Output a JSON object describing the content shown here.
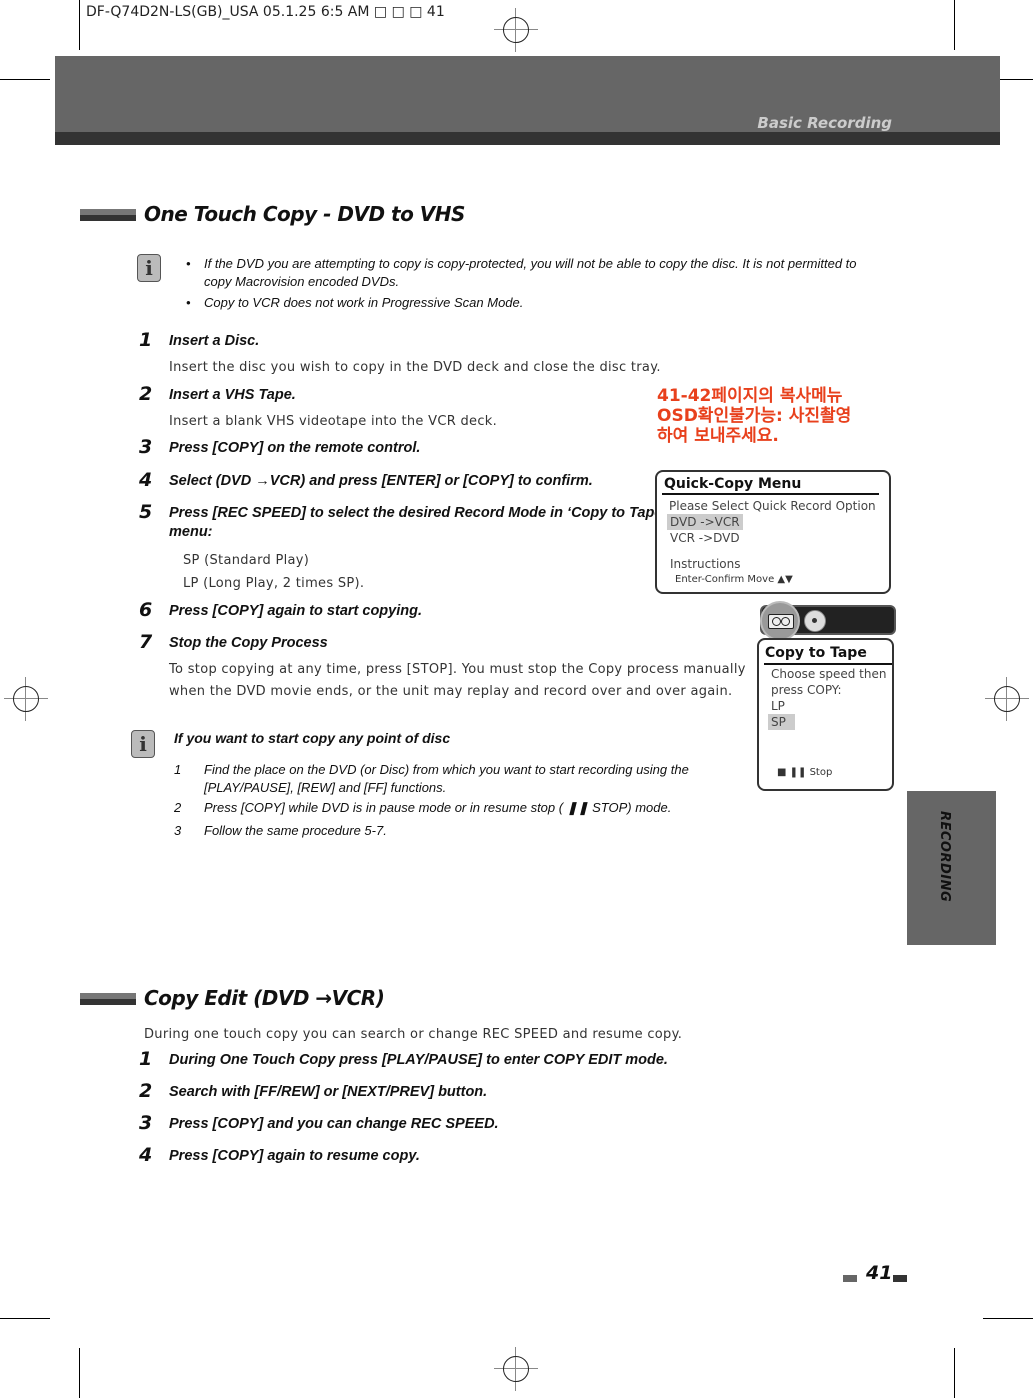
{
  "slug": "DF-Q74D2N-LS(GB)_USA   05.1.25 6:5 AM  □ □ □ 41",
  "header": {
    "section": "Basic Recording"
  },
  "sidebar_tab": {
    "label": "RECORDING"
  },
  "section1": {
    "title": "One Touch Copy - DVD to VHS",
    "notes": [
      "If the DVD you are attempting to copy is copy-protected, you will not be able to copy the disc. It is not permitted to",
      "copy Macrovision encoded DVDs.",
      "Copy to VCR  does not work in Progressive Scan Mode."
    ],
    "steps": [
      {
        "num": "1",
        "head": "Insert a Disc.",
        "body": [
          "Insert the disc you wish to copy in the DVD deck and close the disc tray."
        ]
      },
      {
        "num": "2",
        "head": "Insert a VHS Tape.",
        "body": [
          "Insert a blank VHS videotape into the VCR deck."
        ]
      },
      {
        "num": "3",
        "head": "Press [COPY] on the remote control.",
        "body": []
      },
      {
        "num": "4",
        "head": "Select  (DVD →VCR) and press [ENTER] or [COPY] to confirm.",
        "body": []
      },
      {
        "num": "5",
        "head": "Press [REC SPEED] to select the desired Record Mode in ‘Copy to Tape’",
        "head2": "menu:",
        "body": [
          "SP (Standard Play)",
          "LP (Long Play, 2 times SP)."
        ]
      },
      {
        "num": "6",
        "head": "Press [COPY] again to start copying.",
        "body": []
      },
      {
        "num": "7",
        "head": "Stop the Copy Process",
        "body": [
          "To stop copying at any time, press [STOP]. You must stop the Copy process manually",
          "when the DVD movie ends, or the unit may replay and record over and over again."
        ]
      }
    ],
    "tip": {
      "title": "If you want to start copy any point of disc",
      "items": [
        {
          "num": "1",
          "text": "Find the place on the DVD (or Disc) from which you want to start recording using the",
          "text2": "[PLAY/PAUSE], [REW] and  [FF] functions."
        },
        {
          "num": "2",
          "text": "Press [COPY] while DVD is in pause mode or in resume stop ( ❚❚ STOP) mode."
        },
        {
          "num": "3",
          "text": "Follow the same procedure 5-7."
        }
      ]
    }
  },
  "korean_note": [
    "41-42페이지의  복사메뉴",
    "OSD확인불가능:  사진촬영",
    "하여  보내주세요."
  ],
  "quick_copy_menu": {
    "title": "Quick-Copy Menu",
    "prompt": "Please Select Quick Record Option",
    "options": [
      "DVD ->VCR",
      "VCR ->DVD"
    ],
    "selected": "DVD ->VCR",
    "instructions_label": "Instructions",
    "instructions": "Enter-Confirm  Move ▲▼"
  },
  "copy_to_tape": {
    "title": "Copy to Tape",
    "prompt": [
      "Choose speed then",
      "press COPY:"
    ],
    "options": [
      "LP",
      "SP"
    ],
    "selected": "SP",
    "footer": "■ ❚❚ Stop",
    "icons": [
      "vcr-tape-icon",
      "disc-icon"
    ]
  },
  "section2": {
    "title": "Copy Edit (DVD →VCR)",
    "intro": "During one touch copy you can search or change REC SPEED and resume copy.",
    "steps": [
      {
        "num": "1",
        "head": "During One Touch Copy press [PLAY/PAUSE] to enter COPY EDIT mode."
      },
      {
        "num": "2",
        "head": "Search with [FF/REW] or [NEXT/PREV] button."
      },
      {
        "num": "3",
        "head": "Press [COPY] and you can change REC SPEED."
      },
      {
        "num": "4",
        "head": "Press [COPY] again to resume copy."
      }
    ]
  },
  "page_number": "41"
}
